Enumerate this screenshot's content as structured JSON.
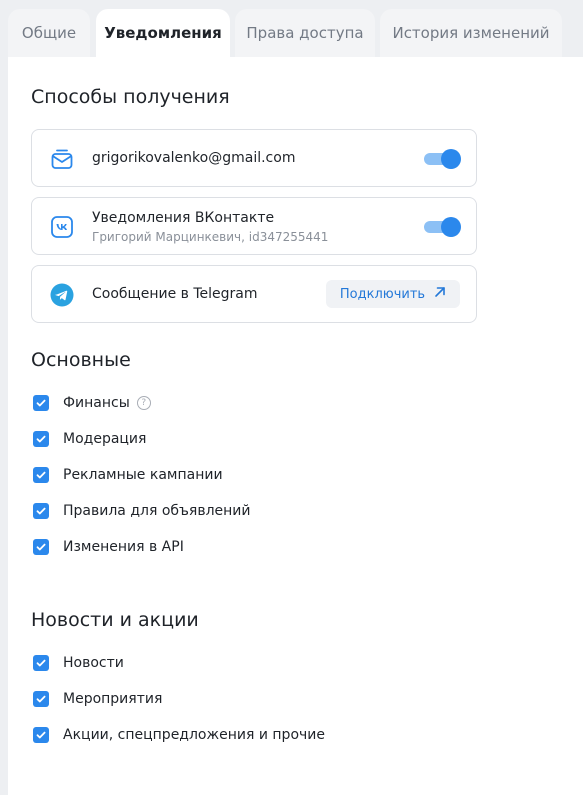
{
  "tabs": [
    {
      "label": "Общие"
    },
    {
      "label": "Уведомления",
      "active": true
    },
    {
      "label": "Права доступа"
    },
    {
      "label": "История изменений"
    }
  ],
  "delivery": {
    "heading": "Способы получения",
    "email": {
      "title": "grigorikovalenko@gmail.com",
      "enabled": true,
      "icon": "mail-icon"
    },
    "vk": {
      "title": "Уведомления ВКонтакте",
      "subtitle": "Григорий Марцинкевич, id347255441",
      "enabled": true,
      "icon": "vk-icon"
    },
    "telegram": {
      "title": "Сообщение в Telegram",
      "button": "Подключить",
      "icon": "telegram-icon"
    }
  },
  "main_section": {
    "heading": "Основные",
    "items": [
      {
        "label": "Финансы",
        "checked": true,
        "help": true
      },
      {
        "label": "Модерация",
        "checked": true
      },
      {
        "label": "Рекламные кампании",
        "checked": true
      },
      {
        "label": "Правила для объявлений",
        "checked": true
      },
      {
        "label": "Изменения в API",
        "checked": true
      }
    ]
  },
  "news_section": {
    "heading": "Новости и акции",
    "items": [
      {
        "label": "Новости",
        "checked": true
      },
      {
        "label": "Мероприятия",
        "checked": true
      },
      {
        "label": "Акции, спецпредложения и прочие",
        "checked": true
      }
    ]
  },
  "colors": {
    "accent": "#2b88ec",
    "toggle_track": "#8cc0f5",
    "link": "#2378d8",
    "telegram": "#2aa2e0"
  }
}
